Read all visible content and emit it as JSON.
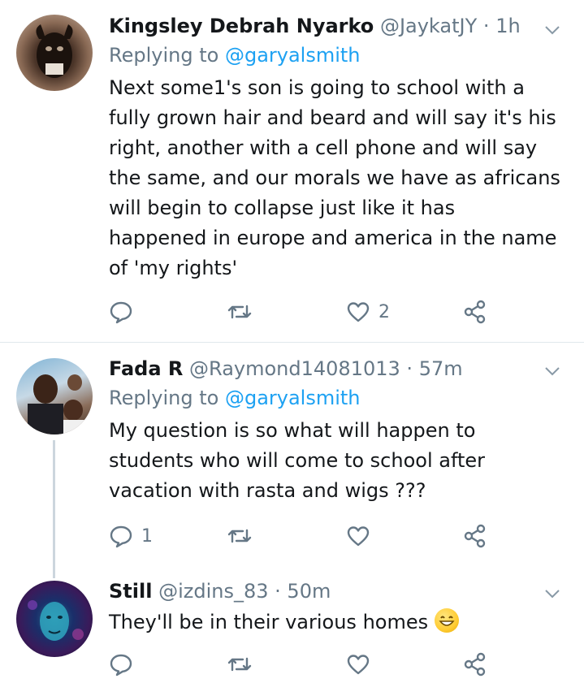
{
  "tweets": [
    {
      "name": "Kingsley Debrah Nyarko",
      "handle": "@JaykatJY",
      "time": "1h",
      "replying_prefix": "Replying to",
      "replying_to": "@garyalsmith",
      "lines": [
        "Next some1's son is going to school with a",
        "fully grown hair and beard and will say it's his",
        "right, another with a cell phone and will say",
        "the same, and our morals we have as africans",
        "will begin to collapse just like it has",
        "happened in europe and america in the name",
        "of 'my rights'"
      ],
      "reply_count": "",
      "retweet_count": "",
      "like_count": "2"
    },
    {
      "name": "Fada R",
      "handle": "@Raymond14081013",
      "time": "57m",
      "replying_prefix": "Replying to",
      "replying_to": "@garyalsmith",
      "lines": [
        "My question  is so what  will happen to",
        "students who will  come to school after",
        "vacation with rasta and wigs ???"
      ],
      "reply_count": "1",
      "retweet_count": "",
      "like_count": ""
    },
    {
      "name": "Still",
      "handle": "@izdins_83",
      "time": "50m",
      "lines": [
        "They'll be in their various homes"
      ],
      "reply_count": "",
      "retweet_count": "",
      "like_count": ""
    }
  ],
  "separator": "·",
  "icons": {
    "reply": "reply-icon",
    "retweet": "retweet-icon",
    "like": "heart-icon",
    "share": "share-icon",
    "menu": "chevron-down-icon",
    "emoji": "grinning-face-emoji"
  },
  "colors": {
    "text": "#14171a",
    "muted": "#657786",
    "link": "#1da1f2",
    "divider": "#e1e8ed"
  }
}
